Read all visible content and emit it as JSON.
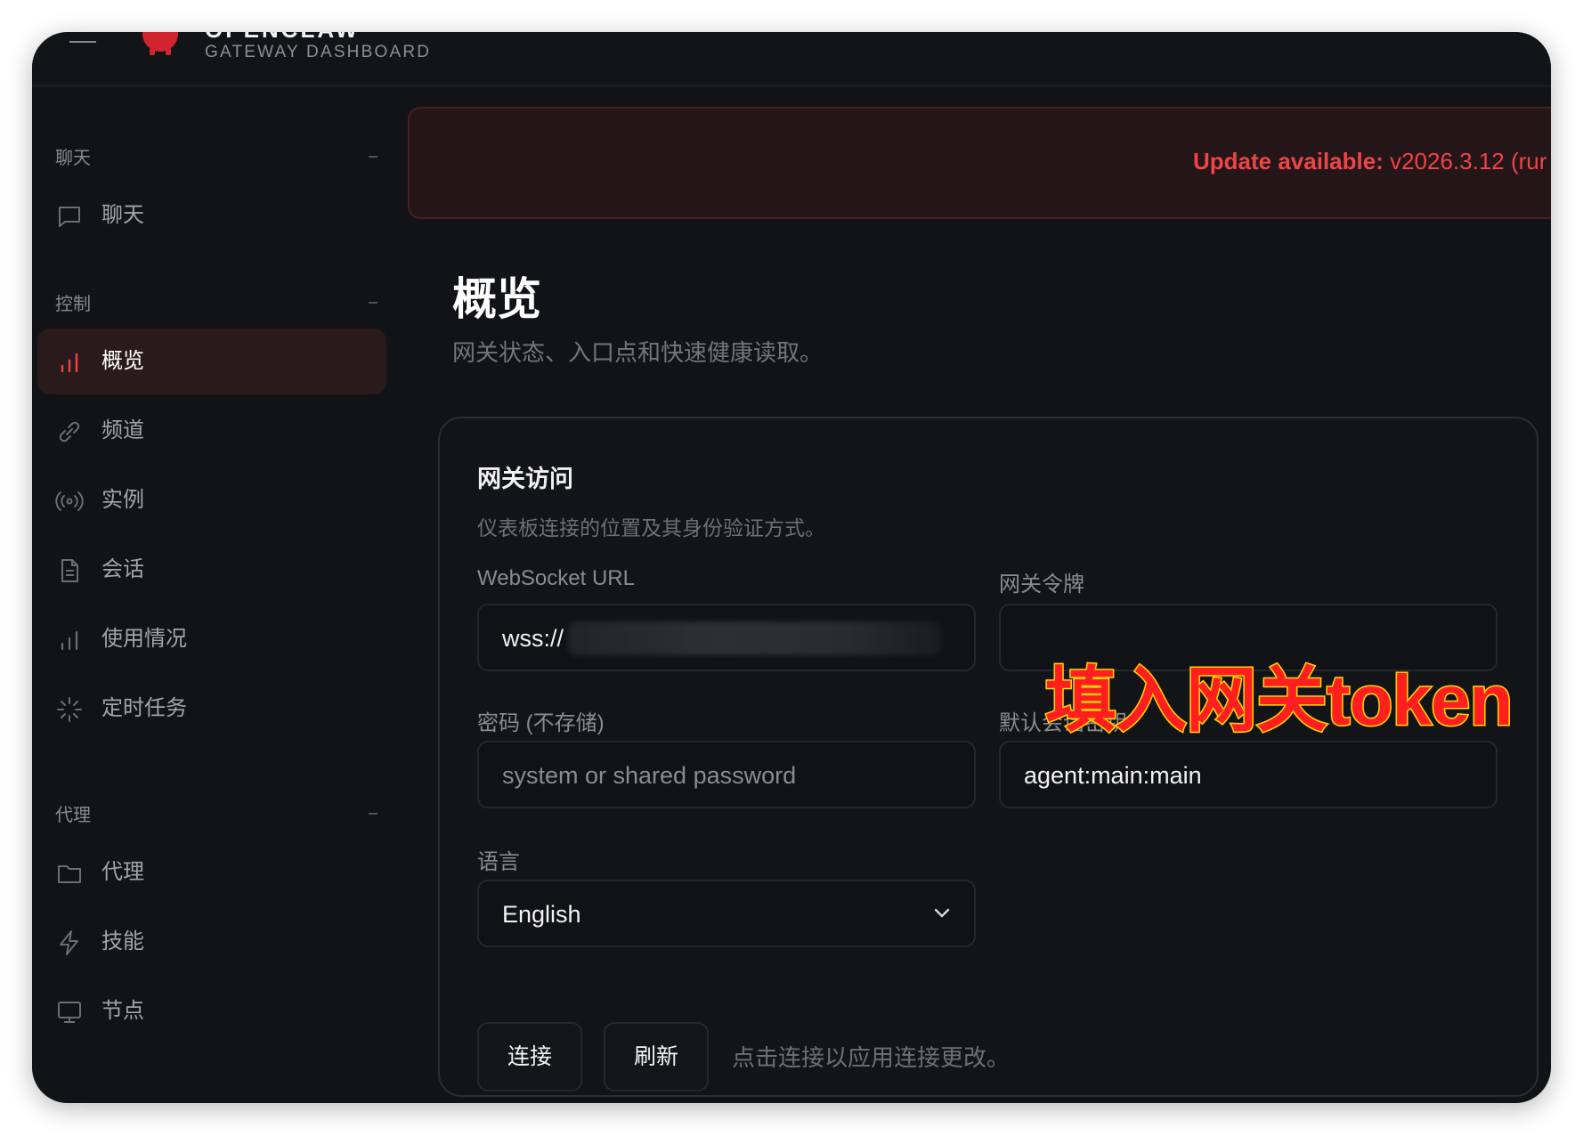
{
  "header": {
    "brand_title": "OPENCLAW",
    "brand_subtitle": "GATEWAY DASHBOARD"
  },
  "sidebar": {
    "sections": [
      {
        "title": "聊天",
        "items": [
          {
            "label": "聊天",
            "icon": "chat-icon"
          }
        ]
      },
      {
        "title": "控制",
        "items": [
          {
            "label": "概览",
            "icon": "bar-chart-icon",
            "active": true
          },
          {
            "label": "频道",
            "icon": "link-icon"
          },
          {
            "label": "实例",
            "icon": "broadcast-icon"
          },
          {
            "label": "会话",
            "icon": "document-icon"
          },
          {
            "label": "使用情况",
            "icon": "bar-chart-icon"
          },
          {
            "label": "定时任务",
            "icon": "loader-icon"
          }
        ]
      },
      {
        "title": "代理",
        "items": [
          {
            "label": "代理",
            "icon": "folder-icon"
          },
          {
            "label": "技能",
            "icon": "lightning-icon"
          },
          {
            "label": "节点",
            "icon": "monitor-icon"
          }
        ]
      }
    ]
  },
  "banner": {
    "prefix": "Update available:",
    "text": "v2026.3.12 (rur"
  },
  "page": {
    "title": "概览",
    "subtitle": "网关状态、入口点和快速健康读取。"
  },
  "card": {
    "title": "网关访问",
    "subtitle": "仪表板连接的位置及其身份验证方式。",
    "ws_label": "WebSocket URL",
    "ws_value": "wss://",
    "token_label": "网关令牌",
    "password_label": "密码 (不存储)",
    "password_placeholder": "system or shared password",
    "session_key_label": "默认会话密钥",
    "session_key_value": "agent:main:main",
    "language_label": "语言",
    "language_value": "English",
    "connect_label": "连接",
    "refresh_label": "刷新",
    "hint": "点击连接以应用连接更改。"
  },
  "annotation": "填入网关token",
  "colors": {
    "accent": "#ef4444",
    "background": "#121316",
    "active_item_bg": "#2a1a1c"
  }
}
